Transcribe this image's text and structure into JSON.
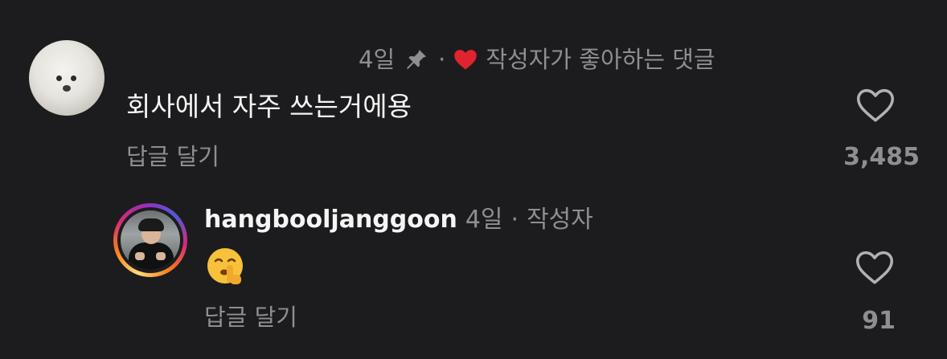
{
  "comment": {
    "time": "4일",
    "dot": "·",
    "liked_label": "작성자가 좋아하는 댓글",
    "text": "회사에서 자주 쓰는거에용",
    "reply_label": "답글 달기",
    "like_count": "3,485",
    "pin_icon": "pin-icon",
    "liked_heart_color": "#e0242e"
  },
  "reply": {
    "username": "hangbooljanggoon",
    "time": "4일",
    "dot": "·",
    "author_label": "작성자",
    "emoji": "🤫",
    "reply_label": "답글 달기",
    "like_count": "91"
  },
  "colors": {
    "background": "#1c1c1e",
    "muted_text": "#8e8e93",
    "primary_text": "#f5f5f5"
  }
}
